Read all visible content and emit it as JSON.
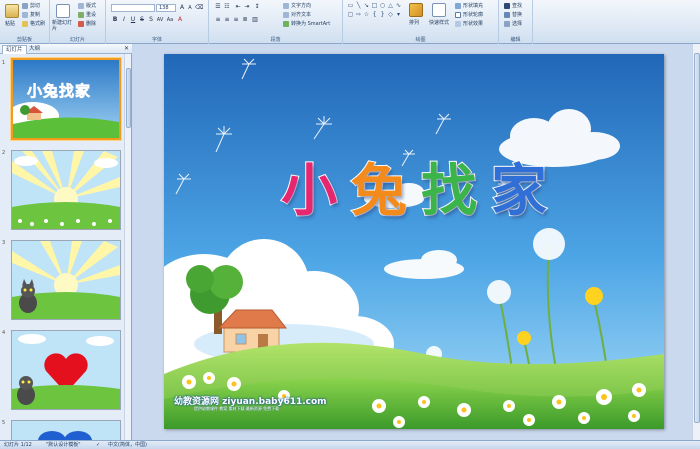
{
  "ribbon": {
    "clipboard": {
      "label": "剪贴板",
      "paste": "粘贴",
      "cut": "剪切",
      "copy": "复制",
      "format_painter": "格式刷"
    },
    "slides": {
      "label": "幻灯片",
      "new_slide": "新建幻灯片",
      "layout": "版式",
      "reset": "重设",
      "delete": "删除"
    },
    "font": {
      "label": "字体",
      "font_name": "",
      "font_size": "138"
    },
    "paragraph": {
      "label": "段落",
      "text_direction": "文字方向",
      "align_text": "对齐文本",
      "smartart": "转换为 SmartArt"
    },
    "drawing": {
      "label": "绘图",
      "arrange": "排列",
      "quick_styles": "快速样式",
      "shape_fill": "形状填充",
      "shape_outline": "形状轮廓",
      "shape_effects": "形状效果"
    },
    "editing": {
      "label": "编辑",
      "find": "查找",
      "replace": "替换",
      "select": "选择"
    }
  },
  "panel": {
    "tab_slides": "幻灯片",
    "tab_outline": "大纲",
    "thumbnails": [
      {
        "num": "1",
        "title": "小兔找家"
      },
      {
        "num": "2"
      },
      {
        "num": "3"
      },
      {
        "num": "4"
      },
      {
        "num": "5"
      }
    ]
  },
  "slide": {
    "title_chars": [
      "小",
      "兔",
      "找",
      "家"
    ],
    "title_colors": [
      "#e8256f",
      "#f28a1c",
      "#3bb44a",
      "#2f6fd6"
    ],
    "watermark_site": "幼教资源网 ziyuan.baby611.com",
    "watermark_sub": "提供幼教课件 教案 素材下载 最新资源 免费下载"
  },
  "status": {
    "slide_info": "幻灯片 1/12",
    "theme": "\"默认设计模板\"",
    "language": "中文(简体，中国)"
  },
  "colors": {
    "ribbon_bg": "#dfe9f5",
    "workspace_bg": "#cad9ee",
    "selection": "#f29b1e"
  }
}
